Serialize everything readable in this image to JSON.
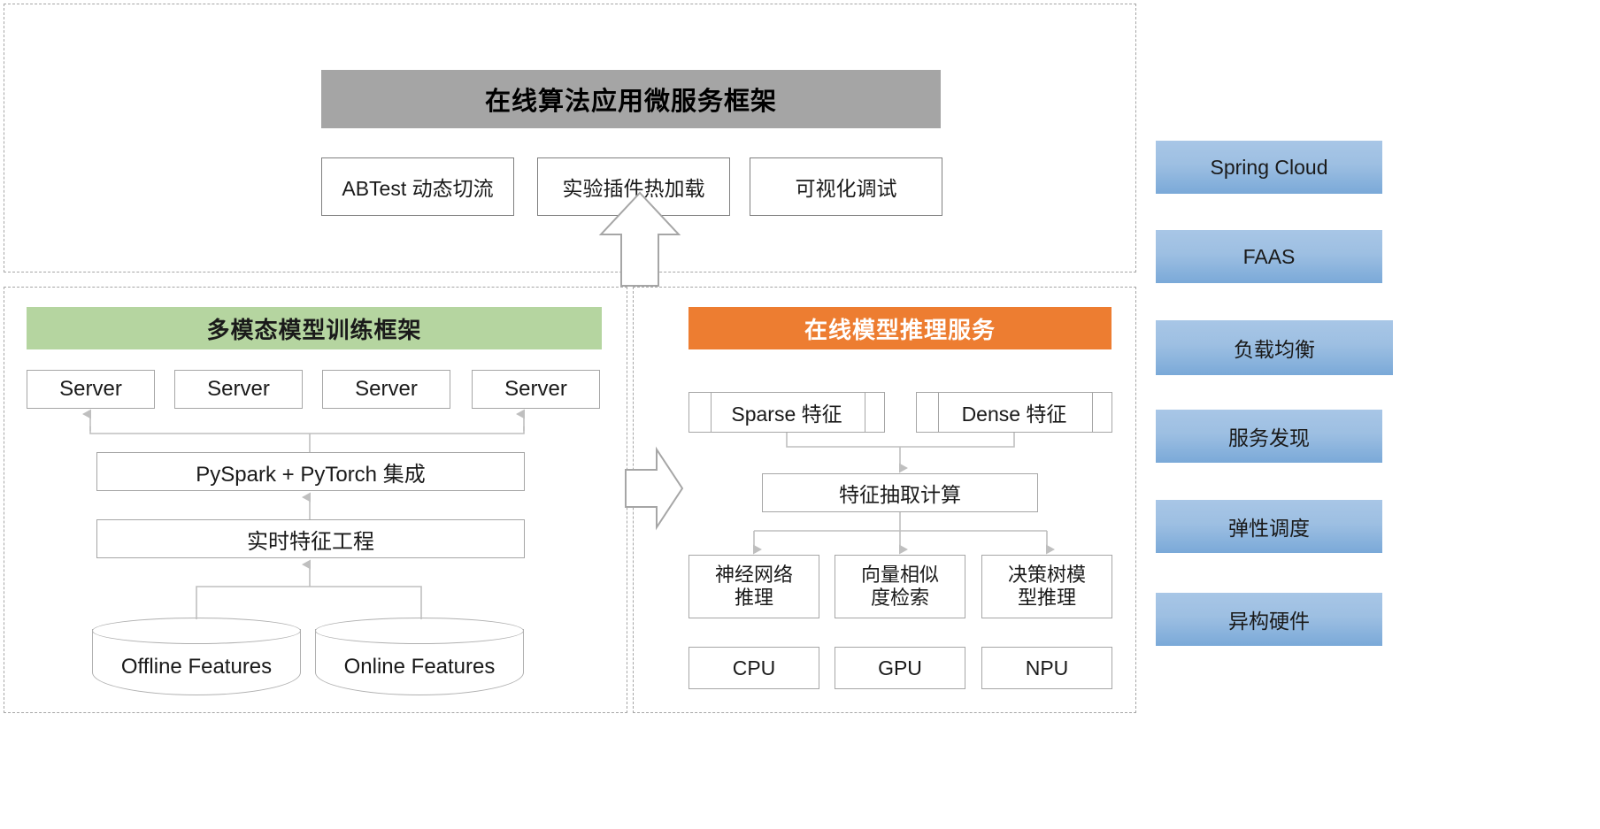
{
  "diagram": {
    "title": "在线算法应用微服务框架",
    "regions": {
      "top": {
        "header": "在线算法应用微服务框架",
        "items": [
          {
            "label": "ABTest 动态切流"
          },
          {
            "label": "实验插件热加载"
          },
          {
            "label": "可视化调试"
          }
        ]
      },
      "training": {
        "header": "多模态模型训练框架",
        "servers": [
          {
            "label": "Server"
          },
          {
            "label": "Server"
          },
          {
            "label": "Server"
          },
          {
            "label": "Server"
          }
        ],
        "integration": "PySpark + PyTorch 集成",
        "feature_engineering": "实时特征工程",
        "stores": [
          {
            "label": "Offline Features"
          },
          {
            "label": "Online Features"
          }
        ]
      },
      "inference": {
        "header": "在线模型推理服务",
        "features": [
          {
            "label": "Sparse 特征"
          },
          {
            "label": "Dense 特征"
          }
        ],
        "extraction": "特征抽取计算",
        "models": [
          {
            "label": "神经网络\n推理"
          },
          {
            "label": "向量相似\n度检索"
          },
          {
            "label": "决策树模\n型推理"
          }
        ],
        "hardware": [
          {
            "label": "CPU"
          },
          {
            "label": "GPU"
          },
          {
            "label": "NPU"
          }
        ]
      }
    },
    "sidebar": {
      "items": [
        {
          "label": "Spring Cloud"
        },
        {
          "label": "FAAS"
        },
        {
          "label": "负载均衡"
        },
        {
          "label": "服务发现"
        },
        {
          "label": "弹性调度"
        },
        {
          "label": "异构硬件"
        }
      ]
    },
    "colors": {
      "header_gray": "#a5a5a5",
      "header_green": "#b5d5a0",
      "header_orange": "#ed7d31",
      "sidebar_blue": "#9dbfe2",
      "line_gray": "#a6a6a6"
    }
  }
}
